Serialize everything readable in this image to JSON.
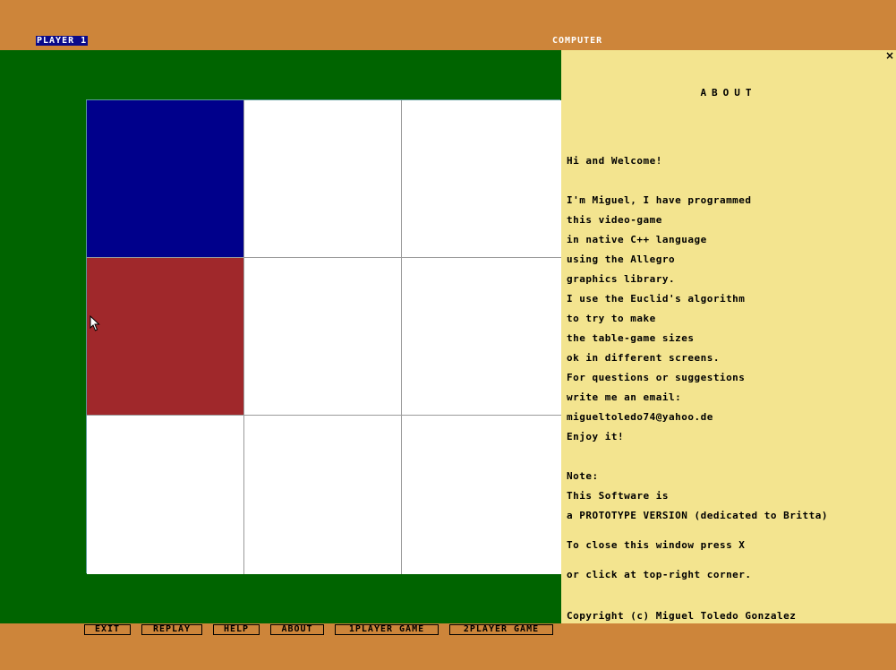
{
  "header": {
    "player1_label": "PLAYER 1",
    "player2_label": "COMPUTER"
  },
  "board": {
    "rows": 3,
    "cols": 3,
    "cells": [
      [
        "blue",
        "empty",
        "empty"
      ],
      [
        "red",
        "empty",
        "empty"
      ],
      [
        "empty",
        "empty",
        "empty"
      ]
    ],
    "colors": {
      "player1": "#00008b",
      "computer": "#a0282b",
      "empty": "#ffffff",
      "background": "#006400"
    }
  },
  "about": {
    "close_label": "×",
    "title": "ABOUT",
    "lines": [
      "Hi and Welcome!",
      "I'm Miguel, I have programmed",
      "this video-game",
      "in native C++ language",
      "using the Allegro",
      "graphics library.",
      "I use the Euclid's algorithm",
      "to try to make",
      "the table-game sizes",
      "ok in different screens.",
      "For questions or suggestions",
      "write me an email:",
      "migueltoledo74@yahoo.de",
      "Enjoy it!",
      "Note:",
      "This Software is",
      "a PROTOTYPE VERSION (dedicated to Britta)",
      "To close this window press X",
      "or click at top-right corner.",
      "Copyright (c) Miguel Toledo Gonzalez"
    ]
  },
  "menu": {
    "exit": "EXIT",
    "replay": "REPLAY",
    "help": "HELP",
    "about": "ABOUT",
    "one_player": "1PLAYER GAME",
    "two_player": "2PLAYER GAME"
  },
  "colors": {
    "frame": "#cd853a",
    "about_bg": "#f3e48f",
    "player_badge": "#0a0a8a"
  }
}
